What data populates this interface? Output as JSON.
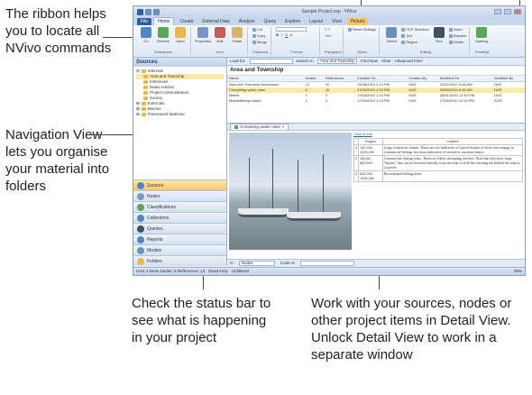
{
  "callouts": {
    "ribbon": "The ribbon helps you to locate all NVivo commands",
    "navigation": "Navigation View lets you organise your material into folders",
    "status": "Check the status bar to see what is happening in your project",
    "detail": "Work with your sources, nodes or other project items in Detail View. Unlock Detail View to work in a separate window"
  },
  "app": {
    "title": "Sample Project.nvp - NVivo",
    "tabs": [
      "File",
      "Home",
      "Create",
      "External Data",
      "Analyze",
      "Query",
      "Explore",
      "Layout",
      "View",
      "Picture"
    ],
    "active_tab": "Home",
    "ribbon_groups": [
      {
        "name": "Workspace",
        "buttons": [
          "Go",
          "Refresh",
          "Open"
        ]
      },
      {
        "name": "Item",
        "buttons": [
          "Properties",
          "Edit",
          "Paste"
        ]
      },
      {
        "name": "Clipboard",
        "small": [
          "Cut",
          "Copy",
          "Merge"
        ]
      },
      {
        "name": "Format",
        "small": [
          "B I U",
          "A",
          "Reset Settings"
        ]
      },
      {
        "name": "Paragraph",
        "small": [
          "Align",
          "Indent"
        ]
      },
      {
        "name": "Styles",
        "small": [
          "Reset Settings"
        ]
      },
      {
        "name": "Editing",
        "small": [
          "PDF Selection",
          "Text",
          "Region",
          "Find",
          "Replace",
          "Delete"
        ]
      },
      {
        "name": "Proofing",
        "buttons": [
          "Spelling"
        ]
      }
    ],
    "ribbon_buttons": {
      "go": "Go",
      "refresh": "Refresh",
      "open": "Open",
      "properties": "Properties",
      "edit": "Edit",
      "paste": "Paste",
      "select": "Select",
      "find": "Find",
      "spelling": "Spelling"
    },
    "ribbon_small": {
      "cut": "Cut",
      "copy": "Copy",
      "merge": "Merge",
      "reset": "Reset Settings",
      "pdf": "PDF Selection",
      "text": "Text",
      "region": "Region",
      "insert": "Insert",
      "replace": "Replace",
      "delete": "Delete"
    },
    "group_names": {
      "workspace": "Workspace",
      "item": "Item",
      "clipboard": "Clipboard",
      "format": "Format",
      "paragraph": "Paragraph",
      "styles": "Styles",
      "editing": "Editing",
      "proofing": "Proofing"
    }
  },
  "navigation": {
    "header": "Sources",
    "tree": [
      {
        "label": "Internals",
        "level": 0
      },
      {
        "label": "Area and Township",
        "level": 1
      },
      {
        "label": "Interviews",
        "level": 1
      },
      {
        "label": "News Articles",
        "level": 1
      },
      {
        "label": "Project Administration",
        "level": 1
      },
      {
        "label": "Survey",
        "level": 1
      },
      {
        "label": "Externals",
        "level": 0
      },
      {
        "label": "Memos",
        "level": 0
      },
      {
        "label": "Framework Matrices",
        "level": 0
      }
    ],
    "buttons": [
      "Sources",
      "Nodes",
      "Classifications",
      "Collections",
      "Queries",
      "Reports",
      "Models",
      "Folders"
    ],
    "active_button": "Sources"
  },
  "findbar": {
    "look_for": "Look for:",
    "search_in": "Search In",
    "scope": "Area and Township",
    "find_now": "Find Now",
    "clear": "Clear",
    "advanced": "Advanced Find"
  },
  "list": {
    "title": "Area and Township",
    "columns": [
      "Name",
      "Nodes",
      "References",
      "Created On",
      "Created By",
      "Modified On",
      "Modified By"
    ],
    "rows": [
      [
        "Area and Township Information",
        "12",
        "22",
        "22/06/2010 2:14 PM",
        "HAS",
        "22/07/2010 9:46 AM",
        "HAS"
      ],
      [
        "Competing water uses",
        "6",
        "12",
        "17/04/2010 1:03 PM",
        "HAS",
        "20/06/2010 6:46 AM",
        "HAS"
      ],
      [
        "Marsh",
        "1",
        "2",
        "17/04/2010 1:10 PM",
        "HAS",
        "26/01/2010 12:44 PM",
        "HAS"
      ],
      [
        "Marshallberg harbor",
        "1",
        "2",
        "17/04/2010 1:13 PM",
        "HAS",
        "27/06/2010 11:03 PM",
        "EDR"
      ]
    ],
    "selected_row": 1
  },
  "document": {
    "tab": "Competing water uses",
    "code_link": "Click to edit",
    "table_headers": [
      "Region",
      "Content"
    ],
    "rows": [
      {
        "n": "1",
        "region": "140,340 - 1225,490",
        "content": "Large waterfront homes. These are not indicative of typical homes of those who engage in commercial fishing, but more indicative of second or vacation homes."
      },
      {
        "n": "2",
        "region": "160,80 - 800,500",
        "content": "Commercial fishing boats. These are likely shrimping trawlers. Note that they have large \"booms\" that can be lowered laterally from the boat to hold the trawling net behind the boat as it travels."
      },
      {
        "n": "3",
        "region": "815,280 - 1205,490",
        "content": "Recreational fishing boats"
      }
    ]
  },
  "bottom_bar": {
    "in": "In",
    "nodes": "Nodes",
    "code_at": "Code At"
  },
  "status": {
    "text": "HAS   4 Items   Nodes: 5   References: 13",
    "read_only": "Read-Only",
    "unfiltered": "Unfiltered",
    "zoom": "90%"
  },
  "colors": {
    "ribbon_blue": "#2b5fa8",
    "active_nav": "#f7c85f",
    "selection": "#fce9a8"
  }
}
